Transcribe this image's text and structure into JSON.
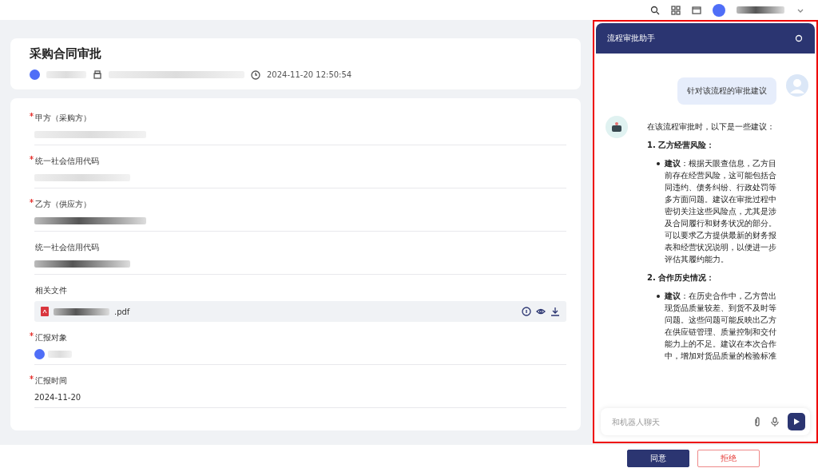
{
  "header": {
    "title": "采购合同审批",
    "timestamp": "2024-11-20 12:50:54"
  },
  "form": {
    "fields": [
      {
        "label": "甲方（采购方）",
        "required": true,
        "kind": "redacted"
      },
      {
        "label": "统一社会信用代码",
        "required": true,
        "kind": "redacted"
      },
      {
        "label": "乙方（供应方）",
        "required": true,
        "kind": "redacted"
      },
      {
        "label": "统一社会信用代码",
        "required": false,
        "kind": "redacted"
      },
      {
        "label": "相关文件",
        "required": false,
        "kind": "file",
        "value": ".pdf"
      },
      {
        "label": "汇报对象",
        "required": true,
        "kind": "person"
      },
      {
        "label": "汇报时间",
        "required": true,
        "kind": "text",
        "value": "2024-11-20"
      }
    ]
  },
  "assistant": {
    "title": "流程审批助手",
    "highlighted": true,
    "user_message": "针对该流程的审批建议",
    "reply_intro": "在该流程审批时，以下是一些建议：",
    "sections": [
      {
        "heading": "1. 乙方经营风险：",
        "bullet": "**建议**：根据天眼查信息，乙方目前存在经营风险，这可能包括合同违约、债务纠纷、行政处罚等多方面问题。建议在审批过程中密切关注这些风险点，尤其是涉及合同履行和财务状况的部分。可以要求乙方提供最新的财务报表和经营状况说明，以便进一步评估其履约能力。"
      },
      {
        "heading": "2. 合作历史情况：",
        "bullet": "**建议**：在历史合作中，乙方曾出现货品质量较差、到货不及时等问题。这些问题可能反映出乙方在供应链管理、质量控制和交付能力上的不足。建议在本次合作中，增加对货品质量的检验标准"
      }
    ],
    "input_placeholder": "和机器人聊天"
  },
  "actions": [
    {
      "label": "同意",
      "kind": "primary"
    },
    {
      "label": "拒绝",
      "kind": "danger"
    }
  ]
}
